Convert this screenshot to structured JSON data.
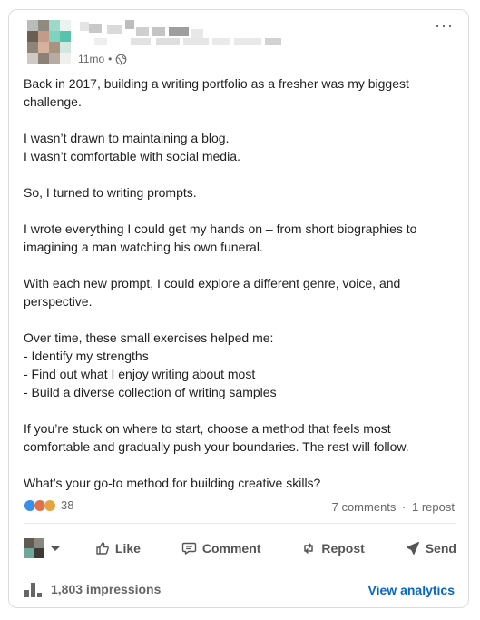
{
  "post": {
    "time": "11mo",
    "dot": "•",
    "more": "···",
    "paragraphs": [
      "Back in 2017, building a writing portfolio as a fresher was my biggest challenge.",
      "I wasn’t drawn to maintaining a blog.\nI wasn’t comfortable with social media.",
      "So, I turned to writing prompts.",
      "I wrote everything I could get my hands on – from short biographies to imagining a man watching his own funeral.",
      "With each new prompt, I could explore a different genre, voice, and perspective.",
      "Over time, these small exercises helped me:\n- Identify my strengths\n- Find out what I enjoy writing about most\n- Build a diverse collection of writing samples",
      "If you’re stuck on where to start, choose a method that feels most comfortable and gradually push your boundaries. The rest will follow.",
      "What’s your go-to method for building creative skills?"
    ]
  },
  "social": {
    "reaction_count": "38",
    "comments": "7 comments",
    "separator": "·",
    "reposts": "1 repost"
  },
  "actions": {
    "like": "Like",
    "comment": "Comment",
    "repost": "Repost",
    "send": "Send"
  },
  "footer": {
    "impressions": "1,803 impressions",
    "view_analytics": "View analytics"
  },
  "colors": {
    "accent": "#0a66c2",
    "like_reaction": "#378fe9",
    "celebrate_reaction": "#df704d",
    "support_reaction": "#e7a33e"
  }
}
